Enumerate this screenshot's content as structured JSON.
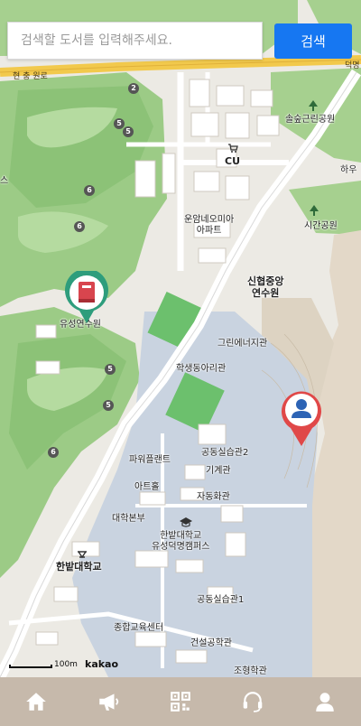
{
  "search": {
    "placeholder": "검색할 도서를 입력해주세요.",
    "value": "",
    "button_label": "검색"
  },
  "map": {
    "road_labels": [
      "현 충 원로",
      "덕명"
    ],
    "labels": [
      "솔숲근린공원",
      "CU",
      "하우",
      "시간공원",
      "운암네오미아\n아파트",
      "스",
      "신협중앙\n연수원",
      "유성연수원",
      "그린에너지관",
      "학생동아리관",
      "공동실습관2",
      "파워플랜트",
      "기계관",
      "아트홀",
      "자동화관",
      "대학본부",
      "한밭대학교\n유성덕명캠퍼스",
      "한밭대학교",
      "공동실습관1",
      "종합교육센터",
      "건설공학관",
      "조형학관"
    ],
    "route_numbers": [
      "2",
      "5",
      "5",
      "6",
      "6",
      "5",
      "5",
      "6"
    ],
    "scale_label": "100m",
    "attribution": "kakao",
    "markers": [
      {
        "type": "library",
        "color": "#2e9d7c",
        "icon": "book-icon"
      },
      {
        "type": "user",
        "color": "#e04848",
        "icon": "person-icon"
      }
    ]
  },
  "nav": {
    "items": [
      {
        "name": "home",
        "icon": "home-icon"
      },
      {
        "name": "notice",
        "icon": "megaphone-icon"
      },
      {
        "name": "qr",
        "icon": "qr-code-icon"
      },
      {
        "name": "support",
        "icon": "headset-icon"
      },
      {
        "name": "profile",
        "icon": "person-icon"
      }
    ],
    "color": "#c6b9ab"
  }
}
